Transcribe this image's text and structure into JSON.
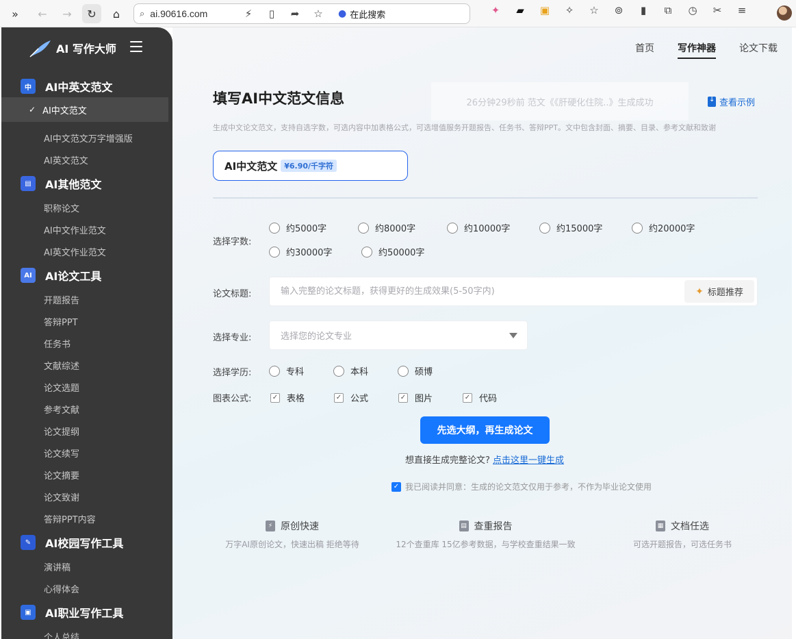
{
  "browser": {
    "url": "ai.90616.com",
    "search_engine_label": "在此搜索"
  },
  "sidebar": {
    "brand": "AI 写作大师",
    "categories": [
      {
        "label": "AI中英文范文",
        "items": [
          "AI中文范文",
          "AI中文范文万字增强版",
          "AI英文范文"
        ]
      },
      {
        "label": "AI其他范文",
        "items": [
          "职称论文",
          "AI中文作业范文",
          "AI英文作业范文"
        ]
      },
      {
        "label": "AI论文工具",
        "items": [
          "开题报告",
          "答辩PPT",
          "任务书",
          "文献综述",
          "论文选题",
          "参考文献",
          "论文提纲",
          "论文续写",
          "论文摘要",
          "论文致谢",
          "答辩PPT内容"
        ]
      },
      {
        "label": "AI校园写作工具",
        "items": [
          "演讲稿",
          "心得体会"
        ]
      },
      {
        "label": "AI职业写作工具",
        "items": [
          "个人总结"
        ]
      }
    ],
    "active_item": "AI中文范文"
  },
  "topnav": {
    "items": [
      "首页",
      "写作神器",
      "论文下载"
    ],
    "active": "写作神器"
  },
  "main": {
    "title": "填写AI中文范文信息",
    "ticker": "26分钟29秒前 范文《《肝硬化住院..》生成成功",
    "example_link": "查看示例",
    "description": "生成中文论文范文，支持自选字数，可选内容中加表格公式，可选增值服务开题报告、任务书、答辩PPT。文中包含封面、摘要、目录、参考文献和致谢",
    "product": {
      "name": "AI中文范文",
      "price": "¥6.90/千字符"
    },
    "word_count": {
      "label": "选择字数:",
      "options": [
        "约5000字",
        "约8000字",
        "约10000字",
        "约15000字",
        "约20000字",
        "约30000字",
        "约50000字"
      ]
    },
    "title_field": {
      "label": "论文标题:",
      "placeholder": "输入完整的论文标题，获得更好的生成效果(5-50字内)",
      "suggest_button": "标题推荐"
    },
    "major_field": {
      "label": "选择专业:",
      "placeholder": "选择您的论文专业"
    },
    "education": {
      "label": "选择学历:",
      "options": [
        "专科",
        "本科",
        "硕博"
      ]
    },
    "extras": {
      "label": "图表公式:",
      "options": [
        "表格",
        "公式",
        "图片",
        "代码"
      ]
    },
    "primary_button": "先选大纲，再生成论文",
    "direct_text": "想直接生成完整论文?",
    "direct_link": "点击这里一键生成",
    "agreement": "我已阅读并同意：生成的论文范文仅用于参考，不作为毕业论文使用",
    "features": [
      {
        "title": "原创快速",
        "desc": "万字AI原创论文，快速出稿 拒绝等待"
      },
      {
        "title": "查重报告",
        "desc": "12个查重库 15亿参考数据，与学校查重结果一致"
      },
      {
        "title": "文档任选",
        "desc": "可选开题报告，可选任务书"
      }
    ]
  }
}
